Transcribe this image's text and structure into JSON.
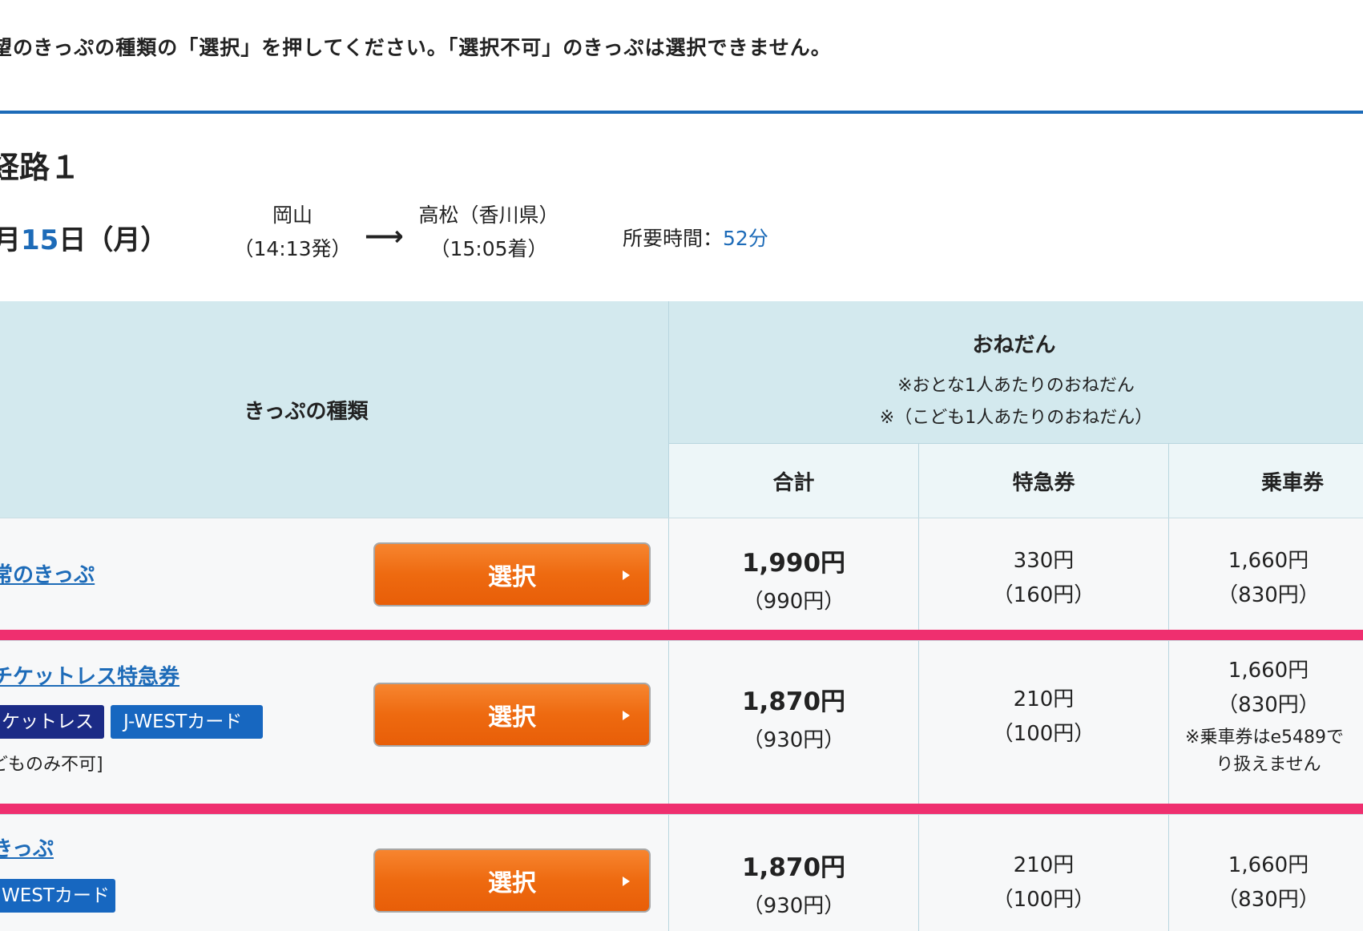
{
  "instruction": "望のきっぷの種類の「選択」を押してください。「選択不可」のきっぷは選択できません。",
  "route": {
    "title": "経路１",
    "date_prefix": "月",
    "date_day": "15",
    "date_suffix": "日（月）",
    "from_station": "岡山",
    "from_time": "（14:13発）",
    "arrow": "⟶",
    "to_station": "高松（香川県）",
    "to_time": "（15:05着）",
    "duration_label": "所要時間：",
    "duration_value": "52分"
  },
  "table": {
    "header_ticket_type": "きっぷの種類",
    "header_price": "おねだん",
    "header_price_note1": "※おとな1人あたりのおねだん",
    "header_price_note2": "※（こども1人あたりのおねだん）",
    "col_total": "合計",
    "col_express": "特急券",
    "col_basic": "乗車券",
    "rows": [
      {
        "ticket_name": "常のきっぷ",
        "select_label": "選択",
        "total": "1,990円",
        "total_child": "（990円）",
        "express": "330円",
        "express_child": "（160円）",
        "basic": "1,660円",
        "basic_child": "（830円）"
      },
      {
        "ticket_name": "チケットレス特急券",
        "badge1": "ケットレス",
        "badge2": "J-WESTカード",
        "note": "どものみ不可]",
        "select_label": "選択",
        "total": "1,870円",
        "total_child": "（930円）",
        "express": "210円",
        "express_child": "（100円）",
        "basic": "1,660円",
        "basic_child": "（830円）",
        "basic_note1": "※乗車券はe5489で",
        "basic_note2": "り扱えません"
      },
      {
        "ticket_name": "きっぷ",
        "badge1": "WESTカード",
        "select_label": "選択",
        "total": "1,870円",
        "total_child": "（930円）",
        "express": "210円",
        "express_child": "（100円）",
        "basic": "1,660円",
        "basic_child": "（830円）"
      }
    ]
  },
  "colors": {
    "accent_blue": "#1d6bb8",
    "select_orange": "#ee6a10",
    "divider_pink": "#ef2f6f",
    "header_bg": "#d3e9ee"
  }
}
